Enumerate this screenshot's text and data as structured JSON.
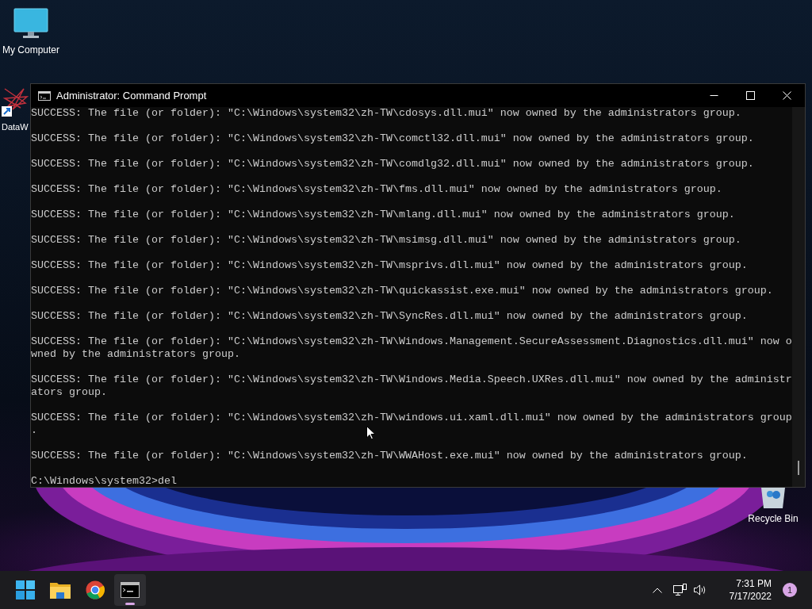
{
  "desktop": {
    "icons": [
      {
        "label": "My Computer",
        "kind": "monitor"
      },
      {
        "label": "DataW",
        "kind": "shortcut"
      },
      {
        "label": "Recycle Bin",
        "kind": "recycle"
      }
    ]
  },
  "window": {
    "title": "Administrator: Command Prompt",
    "entries": [
      {
        "lines": [
          "SUCCESS: The file (or folder): \"C:\\Windows\\system32\\zh-TW\\cdosys.dll.mui\" now owned by the administrators group."
        ]
      },
      {
        "lines": [
          "SUCCESS: The file (or folder): \"C:\\Windows\\system32\\zh-TW\\comctl32.dll.mui\" now owned by the administrators group."
        ]
      },
      {
        "lines": [
          "SUCCESS: The file (or folder): \"C:\\Windows\\system32\\zh-TW\\comdlg32.dll.mui\" now owned by the administrators group."
        ]
      },
      {
        "lines": [
          "SUCCESS: The file (or folder): \"C:\\Windows\\system32\\zh-TW\\fms.dll.mui\" now owned by the administrators group."
        ]
      },
      {
        "lines": [
          "SUCCESS: The file (or folder): \"C:\\Windows\\system32\\zh-TW\\mlang.dll.mui\" now owned by the administrators group."
        ]
      },
      {
        "lines": [
          "SUCCESS: The file (or folder): \"C:\\Windows\\system32\\zh-TW\\msimsg.dll.mui\" now owned by the administrators group."
        ]
      },
      {
        "lines": [
          "SUCCESS: The file (or folder): \"C:\\Windows\\system32\\zh-TW\\msprivs.dll.mui\" now owned by the administrators group."
        ]
      },
      {
        "lines": [
          "SUCCESS: The file (or folder): \"C:\\Windows\\system32\\zh-TW\\quickassist.exe.mui\" now owned by the administrators group."
        ]
      },
      {
        "lines": [
          "SUCCESS: The file (or folder): \"C:\\Windows\\system32\\zh-TW\\SyncRes.dll.mui\" now owned by the administrators group."
        ]
      },
      {
        "lines": [
          "SUCCESS: The file (or folder): \"C:\\Windows\\system32\\zh-TW\\Windows.Management.SecureAssessment.Diagnostics.dll.mui\" now o",
          "wned by the administrators group."
        ]
      },
      {
        "lines": [
          "SUCCESS: The file (or folder): \"C:\\Windows\\system32\\zh-TW\\Windows.Media.Speech.UXRes.dll.mui\" now owned by the administr",
          "ators group."
        ]
      },
      {
        "lines": [
          "SUCCESS: The file (or folder): \"C:\\Windows\\system32\\zh-TW\\windows.ui.xaml.dll.mui\" now owned by the administrators group",
          "."
        ]
      },
      {
        "lines": [
          "SUCCESS: The file (or folder): \"C:\\Windows\\system32\\zh-TW\\WWAHost.exe.mui\" now owned by the administrators group."
        ]
      }
    ],
    "prompt": "C:\\Windows\\system32>del"
  },
  "taskbar": {
    "apps": [
      {
        "kind": "start",
        "selected": false
      },
      {
        "kind": "explorer",
        "selected": false
      },
      {
        "kind": "chrome",
        "selected": false
      },
      {
        "kind": "terminal",
        "selected": true
      }
    ],
    "clock": {
      "time": "7:31 PM",
      "date": "7/17/2022"
    },
    "notification_count": "1"
  }
}
